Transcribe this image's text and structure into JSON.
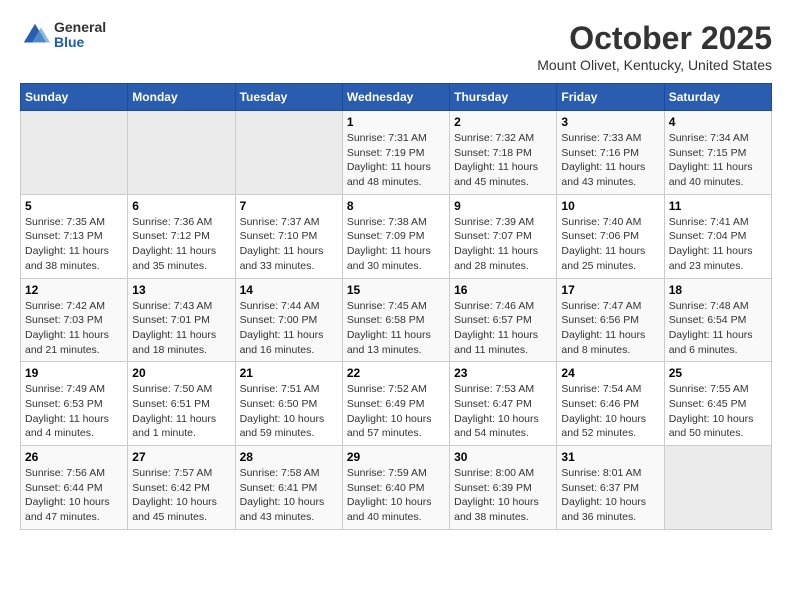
{
  "logo": {
    "general": "General",
    "blue": "Blue"
  },
  "title": "October 2025",
  "location": "Mount Olivet, Kentucky, United States",
  "weekdays": [
    "Sunday",
    "Monday",
    "Tuesday",
    "Wednesday",
    "Thursday",
    "Friday",
    "Saturday"
  ],
  "weeks": [
    [
      {
        "day": "",
        "sunrise": "",
        "sunset": "",
        "daylight": ""
      },
      {
        "day": "",
        "sunrise": "",
        "sunset": "",
        "daylight": ""
      },
      {
        "day": "",
        "sunrise": "",
        "sunset": "",
        "daylight": ""
      },
      {
        "day": "1",
        "sunrise": "7:31 AM",
        "sunset": "7:19 PM",
        "daylight": "11 hours and 48 minutes."
      },
      {
        "day": "2",
        "sunrise": "7:32 AM",
        "sunset": "7:18 PM",
        "daylight": "11 hours and 45 minutes."
      },
      {
        "day": "3",
        "sunrise": "7:33 AM",
        "sunset": "7:16 PM",
        "daylight": "11 hours and 43 minutes."
      },
      {
        "day": "4",
        "sunrise": "7:34 AM",
        "sunset": "7:15 PM",
        "daylight": "11 hours and 40 minutes."
      }
    ],
    [
      {
        "day": "5",
        "sunrise": "7:35 AM",
        "sunset": "7:13 PM",
        "daylight": "11 hours and 38 minutes."
      },
      {
        "day": "6",
        "sunrise": "7:36 AM",
        "sunset": "7:12 PM",
        "daylight": "11 hours and 35 minutes."
      },
      {
        "day": "7",
        "sunrise": "7:37 AM",
        "sunset": "7:10 PM",
        "daylight": "11 hours and 33 minutes."
      },
      {
        "day": "8",
        "sunrise": "7:38 AM",
        "sunset": "7:09 PM",
        "daylight": "11 hours and 30 minutes."
      },
      {
        "day": "9",
        "sunrise": "7:39 AM",
        "sunset": "7:07 PM",
        "daylight": "11 hours and 28 minutes."
      },
      {
        "day": "10",
        "sunrise": "7:40 AM",
        "sunset": "7:06 PM",
        "daylight": "11 hours and 25 minutes."
      },
      {
        "day": "11",
        "sunrise": "7:41 AM",
        "sunset": "7:04 PM",
        "daylight": "11 hours and 23 minutes."
      }
    ],
    [
      {
        "day": "12",
        "sunrise": "7:42 AM",
        "sunset": "7:03 PM",
        "daylight": "11 hours and 21 minutes."
      },
      {
        "day": "13",
        "sunrise": "7:43 AM",
        "sunset": "7:01 PM",
        "daylight": "11 hours and 18 minutes."
      },
      {
        "day": "14",
        "sunrise": "7:44 AM",
        "sunset": "7:00 PM",
        "daylight": "11 hours and 16 minutes."
      },
      {
        "day": "15",
        "sunrise": "7:45 AM",
        "sunset": "6:58 PM",
        "daylight": "11 hours and 13 minutes."
      },
      {
        "day": "16",
        "sunrise": "7:46 AM",
        "sunset": "6:57 PM",
        "daylight": "11 hours and 11 minutes."
      },
      {
        "day": "17",
        "sunrise": "7:47 AM",
        "sunset": "6:56 PM",
        "daylight": "11 hours and 8 minutes."
      },
      {
        "day": "18",
        "sunrise": "7:48 AM",
        "sunset": "6:54 PM",
        "daylight": "11 hours and 6 minutes."
      }
    ],
    [
      {
        "day": "19",
        "sunrise": "7:49 AM",
        "sunset": "6:53 PM",
        "daylight": "11 hours and 4 minutes."
      },
      {
        "day": "20",
        "sunrise": "7:50 AM",
        "sunset": "6:51 PM",
        "daylight": "11 hours and 1 minute."
      },
      {
        "day": "21",
        "sunrise": "7:51 AM",
        "sunset": "6:50 PM",
        "daylight": "10 hours and 59 minutes."
      },
      {
        "day": "22",
        "sunrise": "7:52 AM",
        "sunset": "6:49 PM",
        "daylight": "10 hours and 57 minutes."
      },
      {
        "day": "23",
        "sunrise": "7:53 AM",
        "sunset": "6:47 PM",
        "daylight": "10 hours and 54 minutes."
      },
      {
        "day": "24",
        "sunrise": "7:54 AM",
        "sunset": "6:46 PM",
        "daylight": "10 hours and 52 minutes."
      },
      {
        "day": "25",
        "sunrise": "7:55 AM",
        "sunset": "6:45 PM",
        "daylight": "10 hours and 50 minutes."
      }
    ],
    [
      {
        "day": "26",
        "sunrise": "7:56 AM",
        "sunset": "6:44 PM",
        "daylight": "10 hours and 47 minutes."
      },
      {
        "day": "27",
        "sunrise": "7:57 AM",
        "sunset": "6:42 PM",
        "daylight": "10 hours and 45 minutes."
      },
      {
        "day": "28",
        "sunrise": "7:58 AM",
        "sunset": "6:41 PM",
        "daylight": "10 hours and 43 minutes."
      },
      {
        "day": "29",
        "sunrise": "7:59 AM",
        "sunset": "6:40 PM",
        "daylight": "10 hours and 40 minutes."
      },
      {
        "day": "30",
        "sunrise": "8:00 AM",
        "sunset": "6:39 PM",
        "daylight": "10 hours and 38 minutes."
      },
      {
        "day": "31",
        "sunrise": "8:01 AM",
        "sunset": "6:37 PM",
        "daylight": "10 hours and 36 minutes."
      },
      {
        "day": "",
        "sunrise": "",
        "sunset": "",
        "daylight": ""
      }
    ]
  ]
}
